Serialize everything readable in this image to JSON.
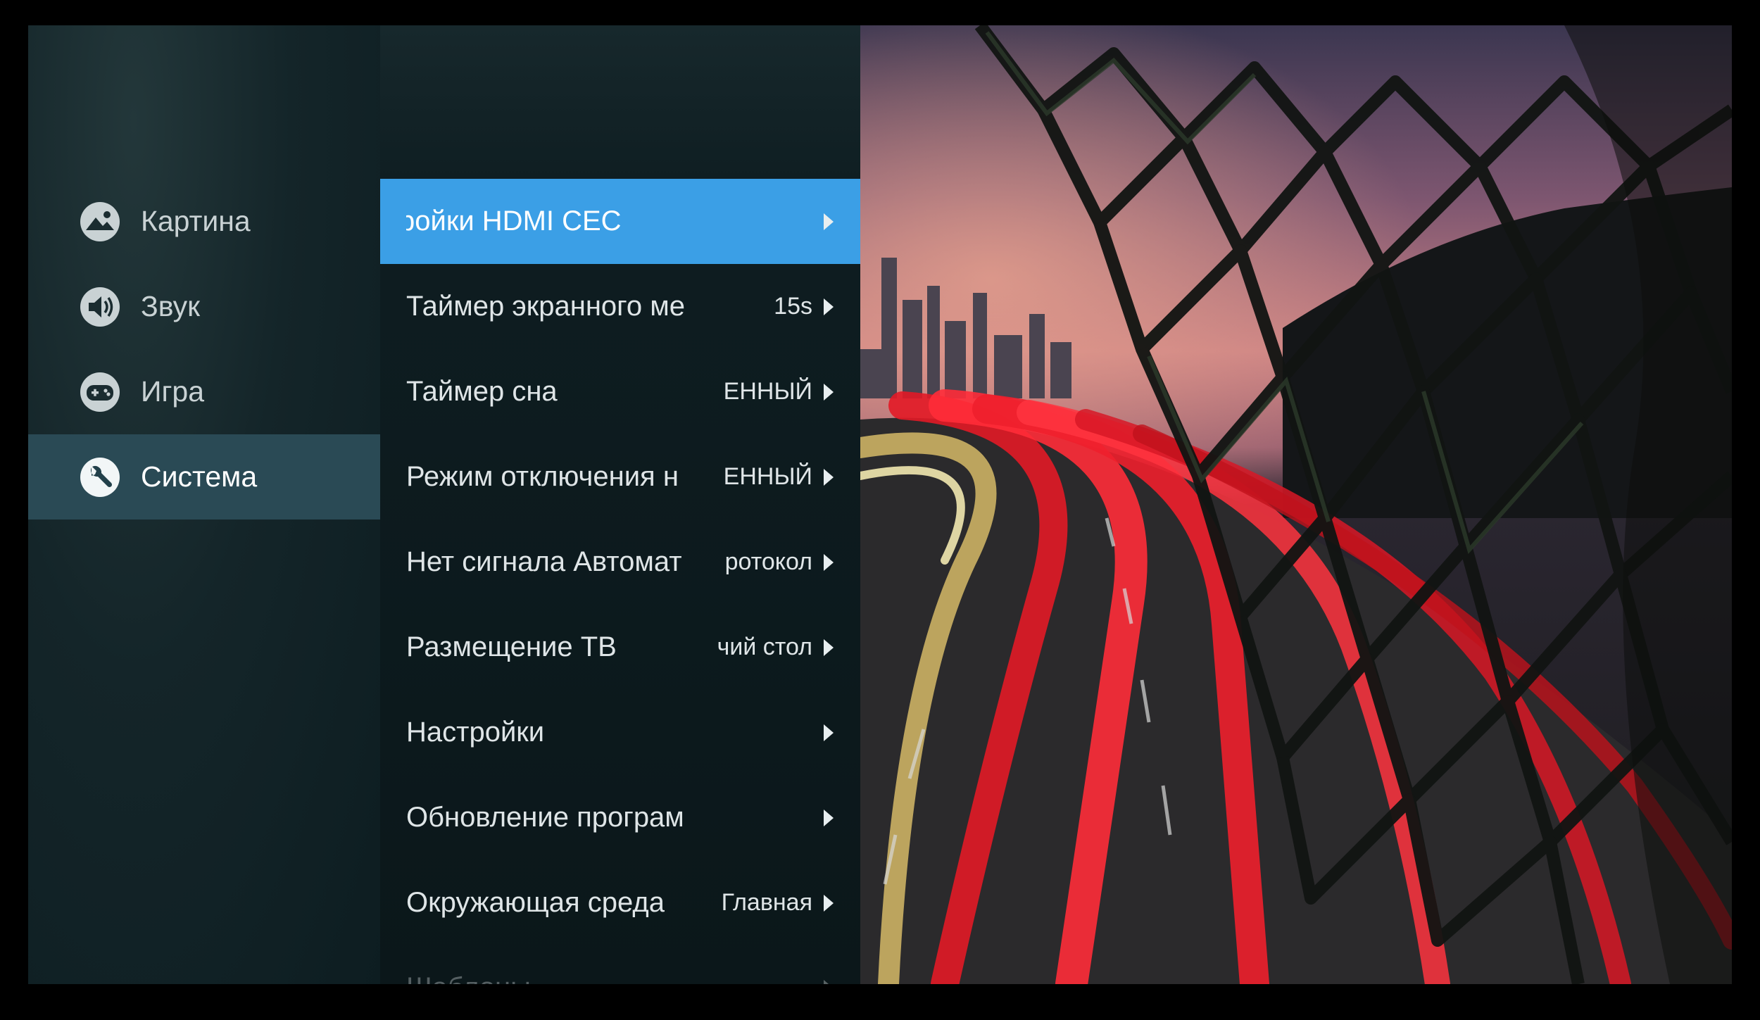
{
  "categories": [
    {
      "label": "Картина",
      "icon": "picture-icon"
    },
    {
      "label": "Звук",
      "icon": "speaker-icon"
    },
    {
      "label": "Игра",
      "icon": "gamepad-icon"
    },
    {
      "label": "Система",
      "icon": "wrench-icon",
      "selected": true
    }
  ],
  "options": [
    {
      "label": "ройки HDMI CEC",
      "value": ""
    },
    {
      "label": "Таймер экранного ме",
      "value": "15s"
    },
    {
      "label": "Таймер сна",
      "value": "ЕННЫЙ"
    },
    {
      "label": "Режим отключения н",
      "value": "ЕННЫЙ"
    },
    {
      "label": "Нет сигнала Автомат",
      "value": "ротокол"
    },
    {
      "label": "Размещение ТВ",
      "value": "чий стол"
    },
    {
      "label": "Настройки",
      "value": ""
    },
    {
      "label": "Обновление програм",
      "value": ""
    },
    {
      "label": "Окружающая среда",
      "value": "Главная"
    },
    {
      "label": "Шаблоны",
      "value": ""
    }
  ],
  "colors": {
    "highlight": "#3b9fe6",
    "category_selected": "#2a4a55"
  }
}
